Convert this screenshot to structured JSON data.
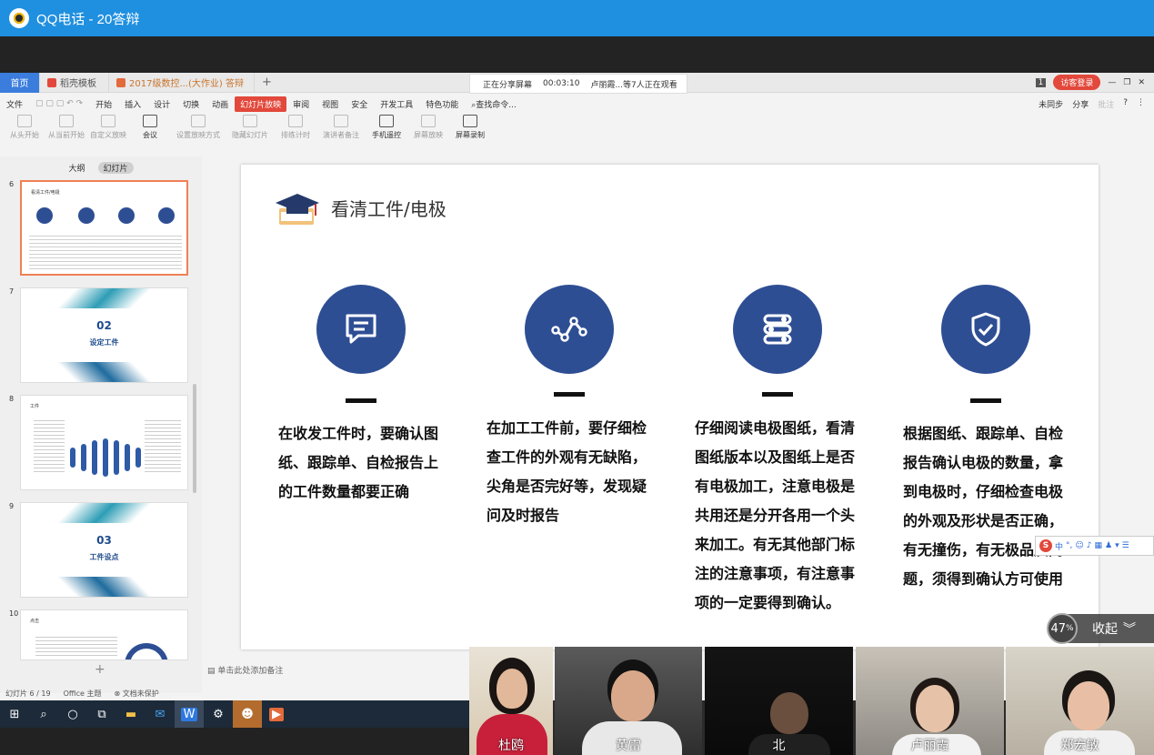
{
  "window": {
    "title": "QQ电话 - 20答辩"
  },
  "wps": {
    "tabs": [
      {
        "label": "首页"
      },
      {
        "label": "稻壳模板"
      },
      {
        "label": "2017级数控...(大作业) 答辩"
      }
    ],
    "share_status": {
      "sharing": "正在分享屏幕",
      "time": "00:03:10",
      "viewers": "卢丽霞...等7人正在观看"
    },
    "visitor_label": "访客登录",
    "menu": [
      "文件",
      "开始",
      "插入",
      "设计",
      "切换",
      "动画",
      "幻灯片放映",
      "审阅",
      "视图",
      "安全",
      "开发工具",
      "特色功能",
      "查找命令..."
    ],
    "menu_right": [
      "未同步",
      "分享",
      "批注"
    ],
    "toolbar": [
      "从头开始",
      "从当前开始",
      "自定义放映",
      "会议",
      "设置放映方式",
      "隐藏幻灯片",
      "排练计时",
      "演讲者备注",
      "手机遥控",
      "屏幕放映",
      "屏幕录制"
    ],
    "sidebar_tabs": [
      "大纲",
      "幻灯片"
    ],
    "slides": [
      {
        "num": "6",
        "title": "看清工件/电极"
      },
      {
        "num": "7",
        "big": "02",
        "sub": "设定工件"
      },
      {
        "num": "8",
        "title": "工件"
      },
      {
        "num": "9",
        "big": "03",
        "sub": "工件设点"
      },
      {
        "num": "10",
        "title": "点击"
      }
    ],
    "notes_placeholder": "单击此处添加备注",
    "status": {
      "slide": "幻灯片 6 / 19",
      "theme": "Office 主题",
      "protect": "文档未保护"
    }
  },
  "slide": {
    "title": "看清工件/电极",
    "columns": [
      {
        "icon": "chat-icon",
        "text": "在收发工件时，要确认图纸、跟踪单、自检报告上的工件数量都要正确"
      },
      {
        "icon": "line-chart-icon",
        "text": "在加工工件前，要仔细检查工件的外观有无缺陷，尖角是否完好等，发现疑问及时报告"
      },
      {
        "icon": "sliders-icon",
        "text": "仔细阅读电极图纸，看清图纸版本以及图纸上是否有电极加工，注意电极是共用还是分开各用一个头来加工。有无其他部门标注的注意事项，有注意事项的一定要得到确认。"
      },
      {
        "icon": "shield-check-icon",
        "text": "根据图纸、跟踪单、自检报告确认电极的数量，拿到电极时，仔细检查电极的外观及形状是否正确，有无撞伤，有无极品质问题，须得到确认方可使用"
      }
    ],
    "accent": "#2e4e94"
  },
  "ime": {
    "lang": "中"
  },
  "call": {
    "float_percent": "47",
    "collapse_label": "收起",
    "participants": [
      "杜鸥",
      "黄雷",
      "北",
      "卢丽霞",
      "郑宏敏"
    ]
  },
  "taskbar": [
    "windows-start-icon",
    "search-icon",
    "task-view-icon",
    "taskview-icon",
    "file-explorer-icon",
    "mail-icon",
    "wps-icon",
    "settings-icon",
    "game-icon",
    "presentation-icon"
  ]
}
